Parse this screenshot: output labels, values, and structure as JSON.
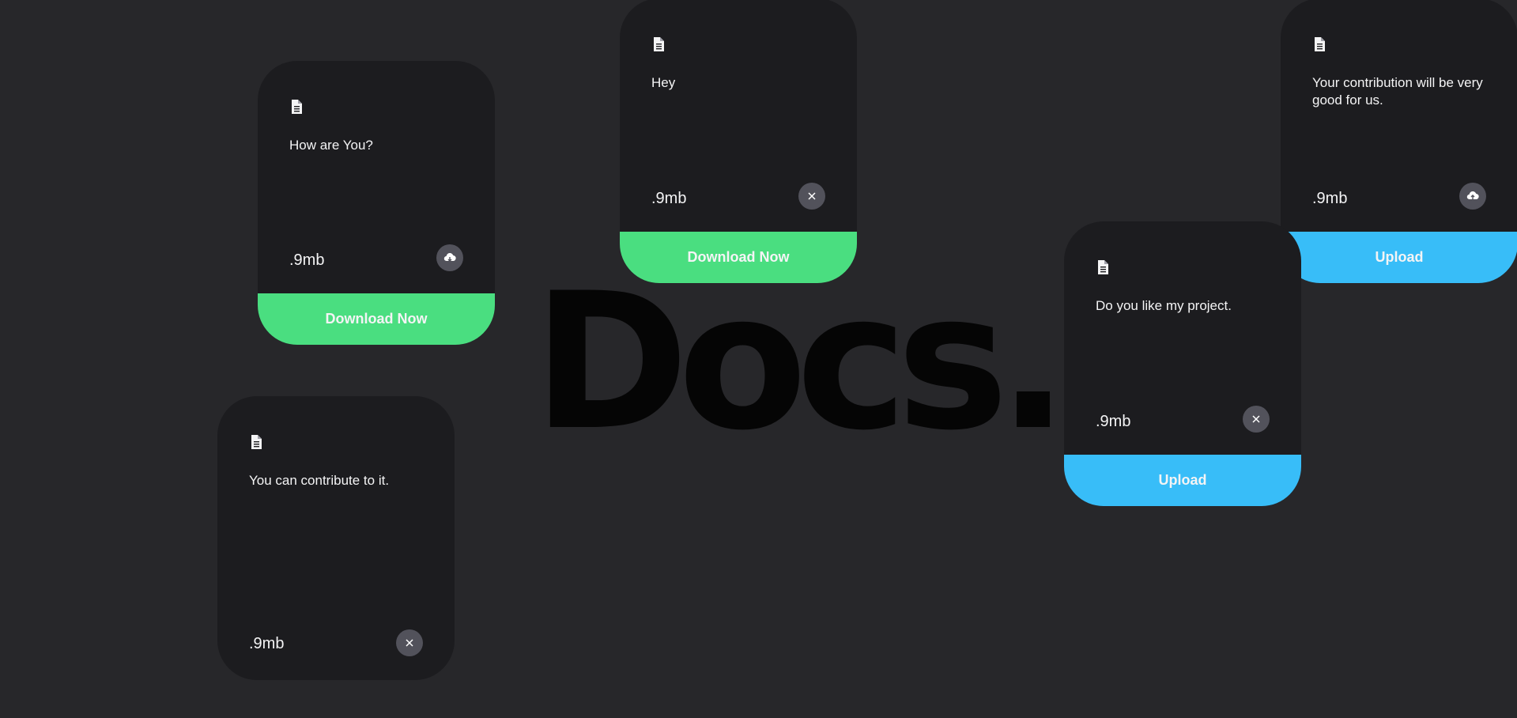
{
  "heading": "Docs.",
  "colors": {
    "background": "#27272a",
    "card": "#1c1c1f",
    "download_button": "#4ade80",
    "upload_button": "#38bdf8",
    "icon_circle": "#52525b"
  },
  "cards": [
    {
      "icon": "document-icon",
      "text": "How are You?",
      "size": ".9mb",
      "action_icon": "cloud-download-icon",
      "button_label": "Download Now"
    },
    {
      "icon": "document-icon",
      "text": "Hey",
      "size": ".9mb",
      "action_icon": "close-icon",
      "button_label": "Download Now"
    },
    {
      "icon": "document-icon",
      "text": "Your contribution will be very good for us.",
      "size": ".9mb",
      "action_icon": "cloud-upload-icon",
      "button_label": "Upload"
    },
    {
      "icon": "document-icon",
      "text": "Do you like my project.",
      "size": ".9mb",
      "action_icon": "close-icon",
      "button_label": "Upload"
    },
    {
      "icon": "document-icon",
      "text": "You can contribute to it.",
      "size": ".9mb",
      "action_icon": "close-icon",
      "button_label": ""
    }
  ]
}
